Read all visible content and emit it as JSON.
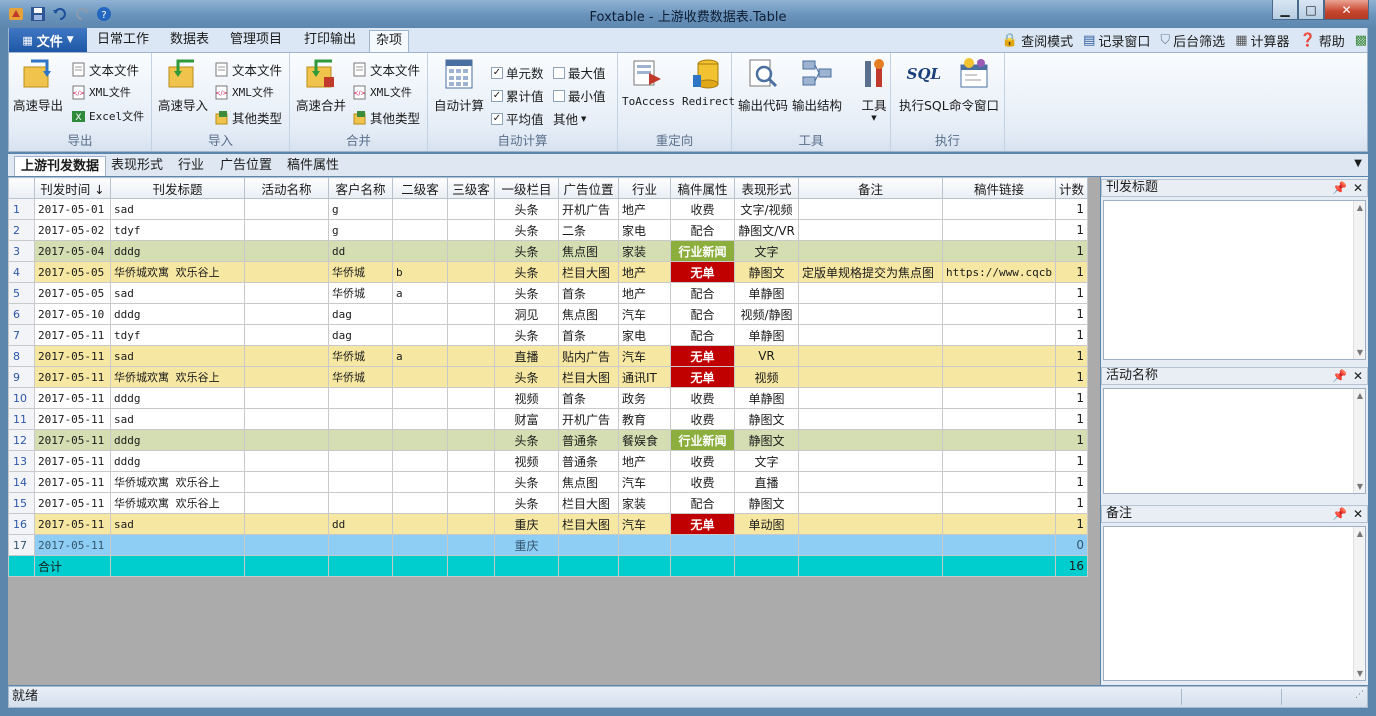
{
  "window": {
    "title": "Foxtable - 上游收费数据表.Table",
    "minimize": "▁",
    "maximize": "□",
    "close": "✕"
  },
  "menu": {
    "file_label": "文件",
    "tabs": [
      "日常工作",
      "数据表",
      "管理项目",
      "打印输出",
      "杂项"
    ],
    "right_tools": [
      "查阅模式",
      "记录窗口",
      "后台筛选",
      "计算器",
      "帮助"
    ]
  },
  "ribbon": {
    "export": {
      "big": "高速导出",
      "text": "文本文件",
      "xml": "XML文件",
      "excel": "Excel文件",
      "group": "导出"
    },
    "import": {
      "big": "高速导入",
      "text": "文本文件",
      "xml": "XML文件",
      "other": "其他类型",
      "group": "导入"
    },
    "merge": {
      "big": "高速合并",
      "text": "文本文件",
      "xml": "XML文件",
      "other": "其他类型",
      "group": "合并"
    },
    "auto": {
      "big": "自动计算",
      "cell": "单元数",
      "cum": "累计值",
      "avg": "平均值",
      "max": "最大值",
      "min": "最小值",
      "other": "其他",
      "group": "自动计算"
    },
    "redirect": {
      "toaccess": "ToAccess",
      "redirect": "Redirect",
      "group": "重定向"
    },
    "tools": {
      "code": "输出代码",
      "struct": "输出结构",
      "tool": "工具",
      "group": "工具"
    },
    "exec": {
      "sql_icon": "SQL",
      "sql": "执行SQL",
      "cmd": "命令窗口",
      "group": "执行"
    }
  },
  "sheet_tabs": [
    "上游刊发数据",
    "表现形式",
    "行业",
    "广告位置",
    "稿件属性"
  ],
  "grid": {
    "headers": [
      "",
      "刊发时间 ↓",
      "刊发标题",
      "活动名称",
      "客户名称",
      "二级客",
      "三级客",
      "一级栏目",
      "广告位置",
      "行业",
      "稿件属性",
      "表现形式",
      "备注",
      "稿件链接",
      "计数"
    ],
    "rows": [
      {
        "n": "1",
        "date": "2017-05-01",
        "title": "sad",
        "act": "",
        "cust": "g",
        "l2": "",
        "l3": "",
        "col": "头条",
        "pos": "开机广告",
        "ind": "地产",
        "attr": "收费",
        "form": "文字/视频",
        "note": "",
        "link": "",
        "cnt": "1"
      },
      {
        "n": "2",
        "date": "2017-05-02",
        "title": "tdyf",
        "act": "",
        "cust": "g",
        "l2": "",
        "l3": "",
        "col": "头条",
        "pos": "二条",
        "ind": "家电",
        "attr": "配合",
        "form": "静图文/VR",
        "note": "",
        "link": "",
        "cnt": "1"
      },
      {
        "n": "3",
        "date": "2017-05-04",
        "title": "dddg",
        "act": "",
        "cust": "dd",
        "l2": "",
        "l3": "",
        "col": "头条",
        "pos": "焦点图",
        "ind": "家装",
        "attr": "行业新闻",
        "form": "文字",
        "note": "",
        "link": "",
        "cnt": "1"
      },
      {
        "n": "4",
        "date": "2017-05-05",
        "title": "华侨城欢寓 欢乐谷上",
        "act": "",
        "cust": "华侨城",
        "l2": "b",
        "l3": "",
        "col": "头条",
        "pos": "栏目大图",
        "ind": "地产",
        "attr": "无单",
        "form": "静图文",
        "note": "定版单规格提交为焦点图",
        "link": "https://www.cqcb",
        "cnt": "1"
      },
      {
        "n": "5",
        "date": "2017-05-05",
        "title": "sad",
        "act": "",
        "cust": "华侨城",
        "l2": "a",
        "l3": "",
        "col": "头条",
        "pos": "首条",
        "ind": "地产",
        "attr": "配合",
        "form": "单静图",
        "note": "",
        "link": "",
        "cnt": "1"
      },
      {
        "n": "6",
        "date": "2017-05-10",
        "title": "dddg",
        "act": "",
        "cust": "dag",
        "l2": "",
        "l3": "",
        "col": "洞见",
        "pos": "焦点图",
        "ind": "汽车",
        "attr": "配合",
        "form": "视频/静图",
        "note": "",
        "link": "",
        "cnt": "1"
      },
      {
        "n": "7",
        "date": "2017-05-11",
        "title": "tdyf",
        "act": "",
        "cust": "dag",
        "l2": "",
        "l3": "",
        "col": "头条",
        "pos": "首条",
        "ind": "家电",
        "attr": "配合",
        "form": "单静图",
        "note": "",
        "link": "",
        "cnt": "1"
      },
      {
        "n": "8",
        "date": "2017-05-11",
        "title": "sad",
        "act": "",
        "cust": "华侨城",
        "l2": "a",
        "l3": "",
        "col": "直播",
        "pos": "贴内广告",
        "ind": "汽车",
        "attr": "无单",
        "form": "VR",
        "note": "",
        "link": "",
        "cnt": "1"
      },
      {
        "n": "9",
        "date": "2017-05-11",
        "title": "华侨城欢寓 欢乐谷上",
        "act": "",
        "cust": "华侨城",
        "l2": "",
        "l3": "",
        "col": "头条",
        "pos": "栏目大图",
        "ind": "通讯IT",
        "attr": "无单",
        "form": "视频",
        "note": "",
        "link": "",
        "cnt": "1"
      },
      {
        "n": "10",
        "date": "2017-05-11",
        "title": "dddg",
        "act": "",
        "cust": "",
        "l2": "",
        "l3": "",
        "col": "视频",
        "pos": "首条",
        "ind": "政务",
        "attr": "收费",
        "form": "单静图",
        "note": "",
        "link": "",
        "cnt": "1"
      },
      {
        "n": "11",
        "date": "2017-05-11",
        "title": "sad",
        "act": "",
        "cust": "",
        "l2": "",
        "l3": "",
        "col": "财富",
        "pos": "开机广告",
        "ind": "教育",
        "attr": "收费",
        "form": "静图文",
        "note": "",
        "link": "",
        "cnt": "1"
      },
      {
        "n": "12",
        "date": "2017-05-11",
        "title": "dddg",
        "act": "",
        "cust": "",
        "l2": "",
        "l3": "",
        "col": "头条",
        "pos": "普通条",
        "ind": "餐娱食",
        "attr": "行业新闻",
        "form": "静图文",
        "note": "",
        "link": "",
        "cnt": "1"
      },
      {
        "n": "13",
        "date": "2017-05-11",
        "title": "dddg",
        "act": "",
        "cust": "",
        "l2": "",
        "l3": "",
        "col": "视频",
        "pos": "普通条",
        "ind": "地产",
        "attr": "收费",
        "form": "文字",
        "note": "",
        "link": "",
        "cnt": "1"
      },
      {
        "n": "14",
        "date": "2017-05-11",
        "title": "华侨城欢寓 欢乐谷上",
        "act": "",
        "cust": "",
        "l2": "",
        "l3": "",
        "col": "头条",
        "pos": "焦点图",
        "ind": "汽车",
        "attr": "收费",
        "form": "直播",
        "note": "",
        "link": "",
        "cnt": "1"
      },
      {
        "n": "15",
        "date": "2017-05-11",
        "title": "华侨城欢寓 欢乐谷上",
        "act": "",
        "cust": "",
        "l2": "",
        "l3": "",
        "col": "头条",
        "pos": "栏目大图",
        "ind": "家装",
        "attr": "配合",
        "form": "静图文",
        "note": "",
        "link": "",
        "cnt": "1"
      },
      {
        "n": "16",
        "date": "2017-05-11",
        "title": "sad",
        "act": "",
        "cust": "dd",
        "l2": "",
        "l3": "",
        "col": "重庆",
        "pos": "栏目大图",
        "ind": "汽车",
        "attr": "无单",
        "form": "单动图",
        "note": "",
        "link": "",
        "cnt": "1"
      },
      {
        "n": "17",
        "date": "2017-05-11",
        "title": "",
        "act": "",
        "cust": "",
        "l2": "",
        "l3": "",
        "col": "重庆",
        "pos": "",
        "ind": "",
        "attr": "",
        "form": "",
        "note": "",
        "link": "",
        "cnt": "0"
      }
    ],
    "total_label": "合计",
    "total_count": "16"
  },
  "side_panels": [
    {
      "title": "刊发标题"
    },
    {
      "title": "活动名称"
    },
    {
      "title": "备注"
    }
  ],
  "status": {
    "text": "就绪"
  },
  "colors": {
    "row_green": "#d5deb2",
    "row_yellow": "#f6e8a2",
    "row_blue": "#8ecdf4",
    "total": "#00cece",
    "badge_red": "#c00000",
    "badge_green": "#8cae3c"
  }
}
